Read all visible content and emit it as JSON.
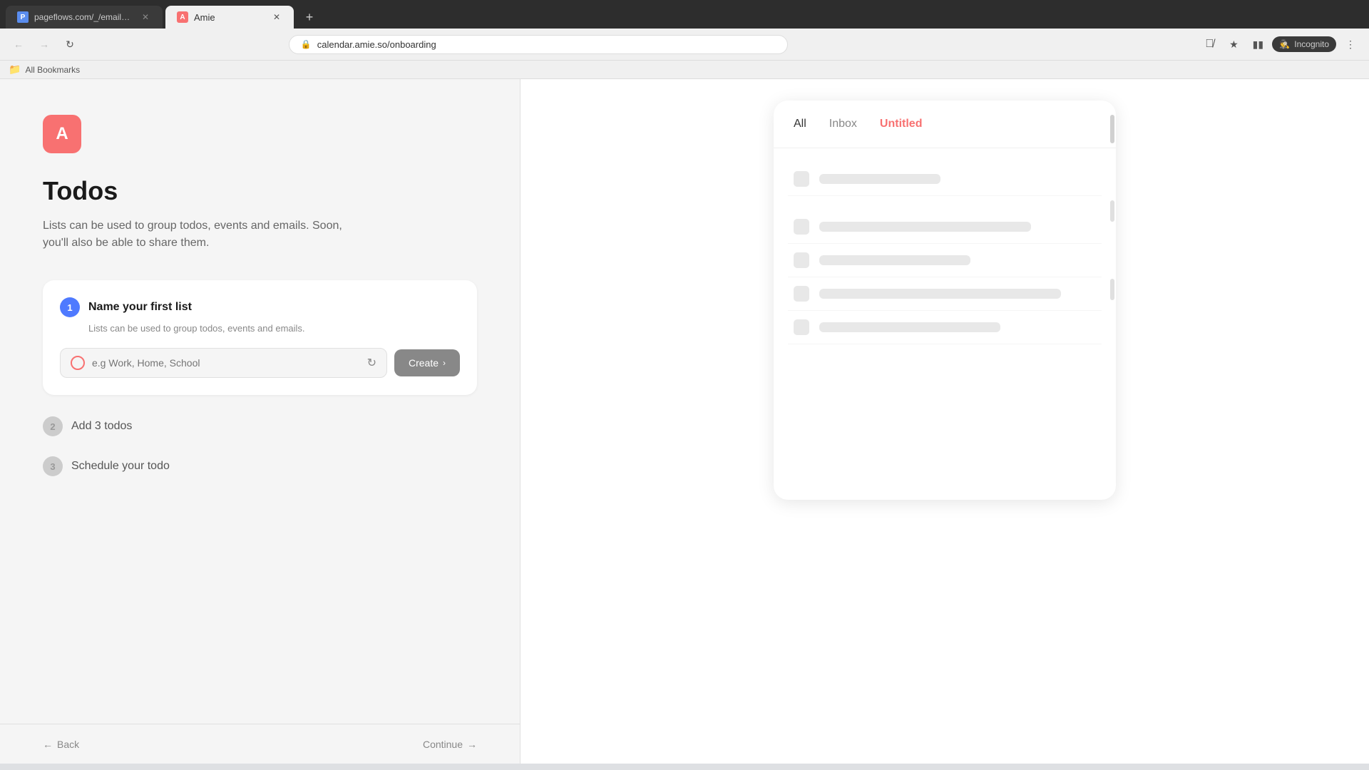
{
  "browser": {
    "tabs": [
      {
        "id": "pageflows",
        "label": "pageflows.com/_/emails/_/7fb...",
        "favicon_text": "P",
        "active": false
      },
      {
        "id": "amie",
        "label": "Amie",
        "favicon_text": "A",
        "active": true
      }
    ],
    "address": "calendar.amie.so/onboarding",
    "new_tab_label": "+",
    "incognito_label": "Incognito",
    "bookmarks_label": "All Bookmarks"
  },
  "left_panel": {
    "logo_text": "A",
    "page_title": "Todos",
    "page_description": "Lists can be used to group todos, events and emails. Soon, you'll also be able to share them.",
    "steps": [
      {
        "number": "1",
        "title": "Name your first list",
        "subtitle": "Lists can be used to group todos, events and emails.",
        "input_placeholder": "e.g Work, Home, School",
        "create_label": "Create",
        "active": true
      },
      {
        "number": "2",
        "title": "Add 3 todos",
        "active": false
      },
      {
        "number": "3",
        "title": "Schedule your todo",
        "active": false
      }
    ],
    "back_label": "Back",
    "continue_label": "Continue"
  },
  "right_panel": {
    "tabs": [
      {
        "id": "all",
        "label": "All",
        "active": false
      },
      {
        "id": "inbox",
        "label": "Inbox",
        "active": false
      },
      {
        "id": "untitled",
        "label": "Untitled",
        "active": true
      }
    ],
    "skeleton_rows": [
      {
        "bar_width": "w-40"
      },
      {
        "bar_width": "w-70"
      },
      {
        "bar_width": "w-50"
      },
      {
        "bar_width": "w-80"
      },
      {
        "bar_width": "w-60"
      }
    ]
  }
}
